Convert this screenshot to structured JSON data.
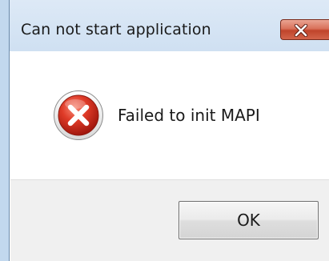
{
  "dialog": {
    "title": "Can not start application",
    "message": "Failed to init MAPI",
    "icon": "error-icon",
    "ok_label": "OK",
    "close_icon": "close-icon"
  },
  "colors": {
    "titlebar": "#d6e5f4",
    "close_button": "#c9543b",
    "error_icon": "#d22b1e",
    "footer": "#f0f0f0"
  }
}
